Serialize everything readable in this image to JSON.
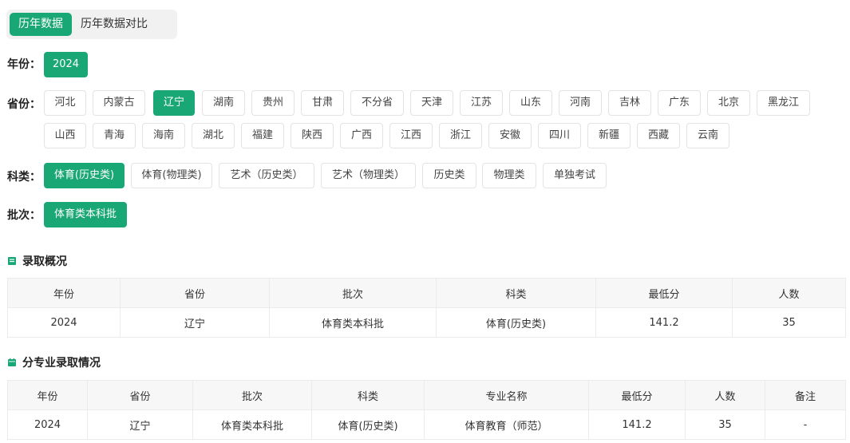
{
  "tabs": [
    {
      "label": "历年数据",
      "active": true
    },
    {
      "label": "历年数据对比",
      "active": false
    }
  ],
  "filters": {
    "year": {
      "label": "年份：",
      "options": [
        {
          "label": "2024",
          "active": true
        }
      ]
    },
    "province": {
      "label": "省份：",
      "options": [
        {
          "label": "河北"
        },
        {
          "label": "内蒙古"
        },
        {
          "label": "辽宁",
          "active": true
        },
        {
          "label": "湖南"
        },
        {
          "label": "贵州"
        },
        {
          "label": "甘肃"
        },
        {
          "label": "不分省"
        },
        {
          "label": "天津"
        },
        {
          "label": "江苏"
        },
        {
          "label": "山东"
        },
        {
          "label": "河南"
        },
        {
          "label": "吉林"
        },
        {
          "label": "广东"
        },
        {
          "label": "北京"
        },
        {
          "label": "黑龙江"
        },
        {
          "label": "山西"
        },
        {
          "label": "青海"
        },
        {
          "label": "海南"
        },
        {
          "label": "湖北"
        },
        {
          "label": "福建"
        },
        {
          "label": "陕西"
        },
        {
          "label": "广西"
        },
        {
          "label": "江西"
        },
        {
          "label": "浙江"
        },
        {
          "label": "安徽"
        },
        {
          "label": "四川"
        },
        {
          "label": "新疆"
        },
        {
          "label": "西藏"
        },
        {
          "label": "云南"
        }
      ]
    },
    "category": {
      "label": "科类：",
      "options": [
        {
          "label": "体育(历史类)",
          "active": true
        },
        {
          "label": "体育(物理类)"
        },
        {
          "label": "艺术（历史类）"
        },
        {
          "label": "艺术（物理类）"
        },
        {
          "label": "历史类"
        },
        {
          "label": "物理类"
        },
        {
          "label": "单独考试"
        }
      ]
    },
    "batch": {
      "label": "批次：",
      "options": [
        {
          "label": "体育类本科批",
          "active": true
        }
      ]
    }
  },
  "overview": {
    "title": "录取概况",
    "columns": [
      "年份",
      "省份",
      "批次",
      "科类",
      "最低分",
      "人数"
    ],
    "rows": [
      [
        "2024",
        "辽宁",
        "体育类本科批",
        "体育(历史类)",
        "141.2",
        "35"
      ]
    ]
  },
  "majors": {
    "title": "分专业录取情况",
    "columns": [
      "年份",
      "省份",
      "批次",
      "科类",
      "专业名称",
      "最低分",
      "人数",
      "备注"
    ],
    "rows": [
      [
        "2024",
        "辽宁",
        "体育类本科批",
        "体育(历史类)",
        "体育教育（师范）",
        "141.2",
        "35",
        "-"
      ]
    ]
  },
  "colors": {
    "accent": "#1aa776"
  }
}
